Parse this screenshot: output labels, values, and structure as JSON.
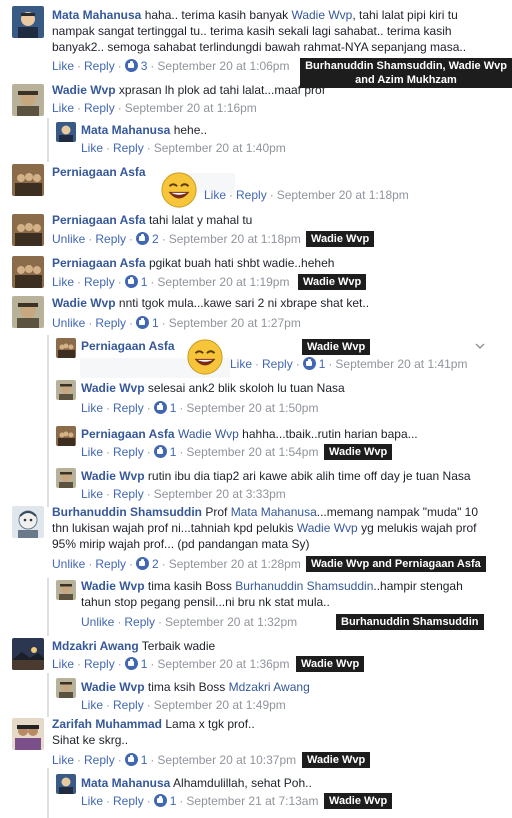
{
  "actions": {
    "like": "Like",
    "unlike": "Unlike",
    "reply": "Reply"
  },
  "comments": [
    {
      "author": "Mata Mahanusa",
      "pre": "haha.. terima kasih banyak ",
      "tag": "Wadie Wvp",
      "post": ", tahi lalat pipi kiri tu",
      "line2": "nampak sangat tertinggal tu.. terima kasih sekali lagi sahabat.. terima kasih",
      "line3": "banyak2.. semoga sahabat terlindungdi bawah rahmat-NYA sepanjang masa..",
      "likes": "3",
      "date": "September 20 at 1:06pm",
      "tooltip1": "Burhanuddin Shamsuddin, Wadie Wvp",
      "tooltip2": "and Azim Mukhzam"
    },
    {
      "author": "Wadie Wvp",
      "text": "xprasan lh plok ad tahi lalat...maaf prof",
      "date": "September 20 at 1:16pm"
    },
    {
      "author": "Mata Mahanusa",
      "text": "hehe..",
      "date": "September 20 at 1:40pm"
    },
    {
      "author": "Perniagaan Asfa",
      "date": "September 20 at 1:18pm"
    },
    {
      "author": "Perniagaan Asfa",
      "text": "tahi lalat y mahal tu",
      "likes": "2",
      "date": "September 20 at 1:18pm",
      "tooltip": "Wadie Wvp"
    },
    {
      "author": "Perniagaan Asfa",
      "text": "pgikat buah hati shbt wadie..heheh",
      "likes": "1",
      "date": "September 20 at 1:19pm",
      "tooltip": "Wadie Wvp"
    },
    {
      "author": "Wadie Wvp",
      "text": "nnti tgok mula...kawe sari 2 ni xbrape shat ket..",
      "likes": "1",
      "date": "September 20 at 1:27pm"
    },
    {
      "author": "Perniagaan Asfa",
      "likes": "1",
      "date": "September 20 at 1:41pm",
      "tooltip": "Wadie Wvp"
    },
    {
      "author": "Wadie Wvp",
      "text": "selesai ank2 blik skoloh lu tuan Nasa",
      "likes": "1",
      "date": "September 20 at 1:50pm"
    },
    {
      "author": "Perniagaan Asfa",
      "tag": "Wadie Wvp",
      "text": " hahha...tbaik..rutin harian bapa...",
      "likes": "1",
      "date": "September 20 at 1:54pm",
      "tooltip": "Wadie Wvp"
    },
    {
      "author": "Wadie Wvp",
      "text": "rutin ibu dia tiap2 ari kawe abik alih time off day je tuan Nasa",
      "date": "September 20 at 3:33pm"
    },
    {
      "author": "Burhanuddin Shamsuddin",
      "pre": " Prof ",
      "tag": "Mata Mahanusa",
      "post": "...memang nampak \"muda\" 10",
      "line2pre": "thn lukisan wajah prof ni...tahniah kpd pelukis ",
      "line2tag": "Wadie Wvp",
      "line2post": " yg melukis wajah prof",
      "line3": "95% mirip wajah prof... (pd pandangan mata Sy)",
      "likes": "2",
      "date": "September 20 at 1:28pm",
      "tooltip": "Wadie Wvp and Perniagaan Asfa"
    },
    {
      "author": "Wadie Wvp",
      "pre": " tima kasih Boss ",
      "tag": "Burhanuddin Shamsuddin",
      "post": "..hampir stengah",
      "line2": "tahun stop pegang pensil...ni bru nk stat mula..",
      "date": "September 20 at 1:32pm",
      "tooltip": "Burhanuddin Shamsuddin"
    },
    {
      "author": "Mdzakri Awang",
      "text": " Terbaik wadie",
      "likes": "1",
      "date": "September 20 at 1:36pm",
      "tooltip": "Wadie Wvp"
    },
    {
      "author": "Wadie Wvp",
      "pre": " tima ksih Boss ",
      "tag": "Mdzakri Awang",
      "date": "September 20 at 1:49pm"
    },
    {
      "author": "Zarifah Muhammad",
      "text": " Lama x tgk prof..",
      "line2": "Sihat ke skrg..",
      "likes": "1",
      "date": "September 20 at 10:37pm",
      "tooltip": "Wadie Wvp"
    },
    {
      "author": "Mata Mahanusa",
      "text": " Alhamdulillah, sehat Poh..",
      "likes": "1",
      "date": "September 21 at 7:13am",
      "tooltip": "Wadie Wvp"
    }
  ]
}
